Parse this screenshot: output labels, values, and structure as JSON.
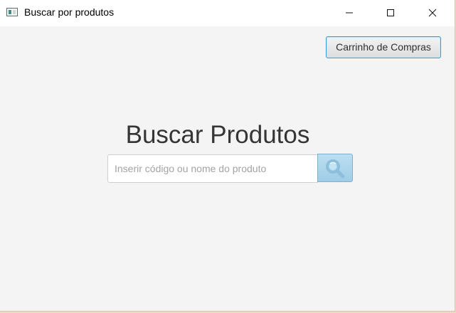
{
  "window": {
    "title": "Buscar por produtos",
    "icon": "app-window-icon",
    "controls": [
      "minimize-icon",
      "maximize-icon",
      "close-icon"
    ]
  },
  "toolbar": {
    "cart_label": "Carrinho de Compras"
  },
  "search": {
    "title": "Buscar Produtos",
    "placeholder": "Inserir código ou nome do produto",
    "value": "",
    "button_icon": "search-icon"
  },
  "colors": {
    "background": "#f4f4f4",
    "accent_border": "#3d9bd1",
    "search_button": "#a8d3ea"
  }
}
